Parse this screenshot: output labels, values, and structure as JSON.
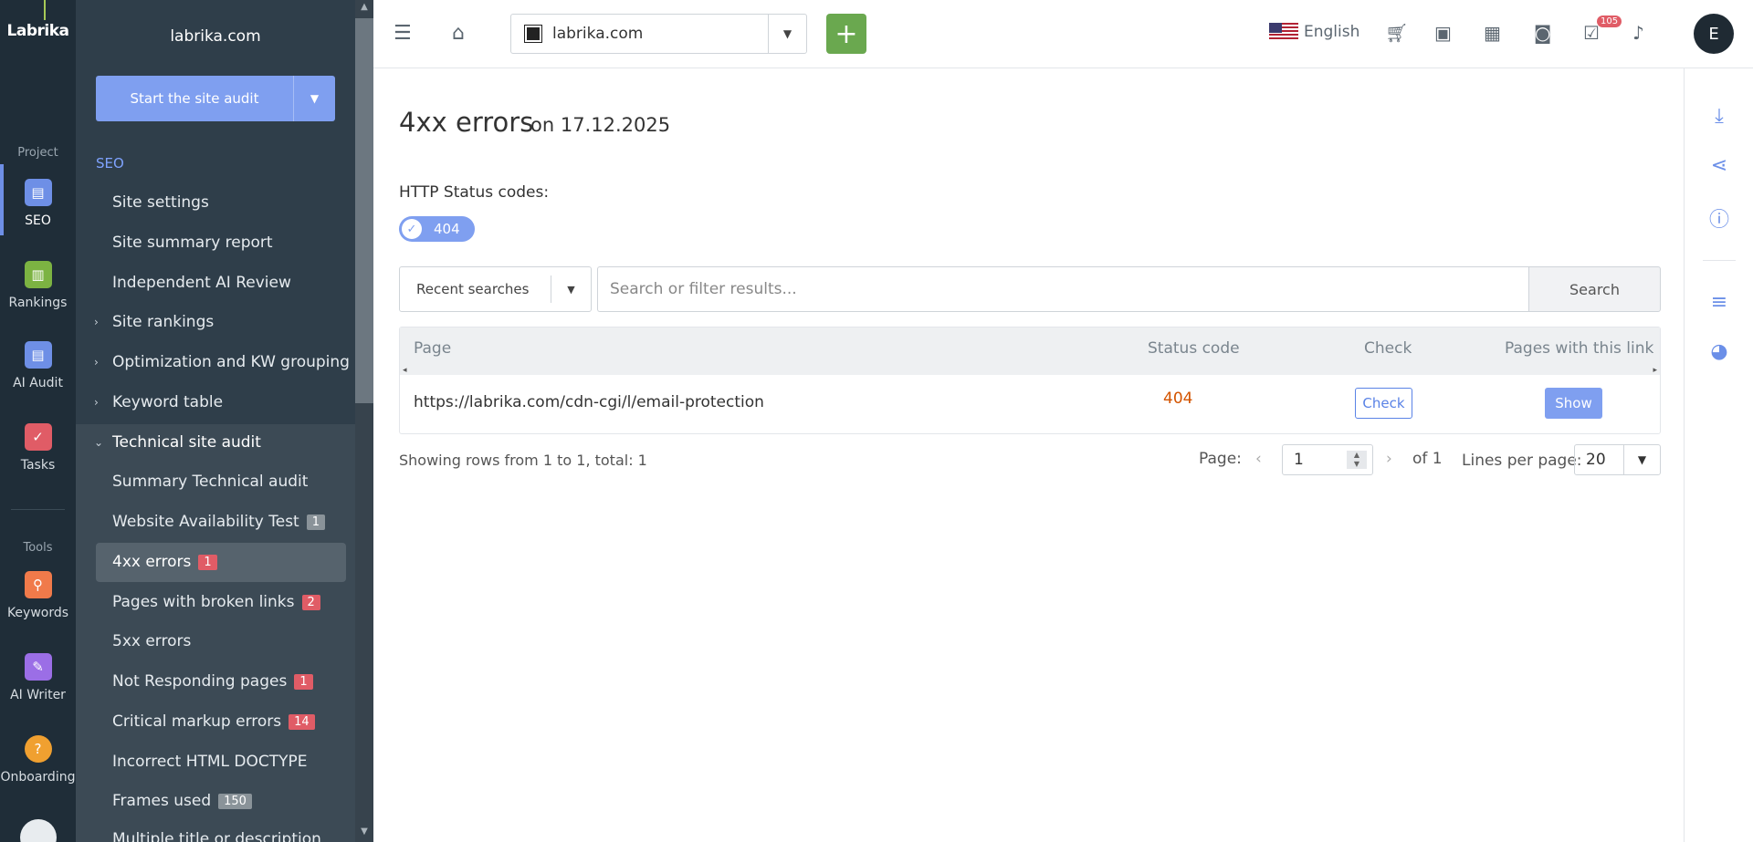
{
  "rail": {
    "logo": "Labrika",
    "project_label": "Project",
    "tools_label": "Tools",
    "items": [
      {
        "label": "SEO",
        "icon": "clipboard-icon",
        "color": "#6e8fe6"
      },
      {
        "label": "Rankings",
        "icon": "chart-icon",
        "color": "#7cb342"
      },
      {
        "label": "AI Audit",
        "icon": "clipboard-icon",
        "color": "#6e8fe6"
      },
      {
        "label": "Tasks",
        "icon": "check-icon",
        "color": "#e05c66"
      },
      {
        "label": "Keywords",
        "icon": "key-icon",
        "color": "#f07a4a"
      },
      {
        "label": "AI Writer",
        "icon": "wand-icon",
        "color": "#9b6ee6"
      },
      {
        "label": "Onboarding",
        "icon": "help-icon",
        "color": "#f0a030"
      }
    ]
  },
  "menu": {
    "domain": "labrika.com",
    "audit_button": "Start the site audit",
    "section_title": "SEO",
    "items": [
      {
        "label": "Site settings"
      },
      {
        "label": "Site summary report"
      },
      {
        "label": "Independent AI Review"
      },
      {
        "label": "Site rankings"
      },
      {
        "label": "Optimization and KW grouping"
      },
      {
        "label": "Keyword table"
      },
      {
        "label": "Technical site audit"
      },
      {
        "label": "Summary Technical audit"
      },
      {
        "label": "Website Availability Test",
        "badge": "1"
      },
      {
        "label": "4xx errors",
        "badge": "1"
      },
      {
        "label": "Pages with broken links",
        "badge": "2"
      },
      {
        "label": "5xx errors"
      },
      {
        "label": "Not Responding pages",
        "badge": "1"
      },
      {
        "label": "Critical markup errors",
        "badge": "14"
      },
      {
        "label": "Incorrect HTML DOCTYPE"
      },
      {
        "label": "Frames used",
        "badge": "150"
      },
      {
        "label": "Multiple title or description"
      }
    ]
  },
  "topbar": {
    "project": "labrika.com",
    "add_label": "+",
    "language": "English",
    "notifications_count": "105",
    "avatar_letter": "E"
  },
  "main": {
    "title": "4xx errors",
    "date": "on 17.12.2025",
    "status_label": "HTTP Status codes:",
    "chip": "404",
    "recent_searches": "Recent searches",
    "search_placeholder": "Search or filter results...",
    "search_button": "Search",
    "table": {
      "headers": [
        "Page",
        "Status code",
        "Check",
        "Pages with this link"
      ],
      "rows": [
        {
          "page": "https://labrika.com/cdn-cgi/l/email-protection",
          "status": "404",
          "check": "Check",
          "show": "Show"
        }
      ]
    },
    "rows_info": "Showing rows from 1 to 1, total: 1",
    "page_label": "Page:",
    "page_value": "1",
    "page_of": "of 1",
    "lines_label": "Lines per page:",
    "lines_value": "20"
  }
}
